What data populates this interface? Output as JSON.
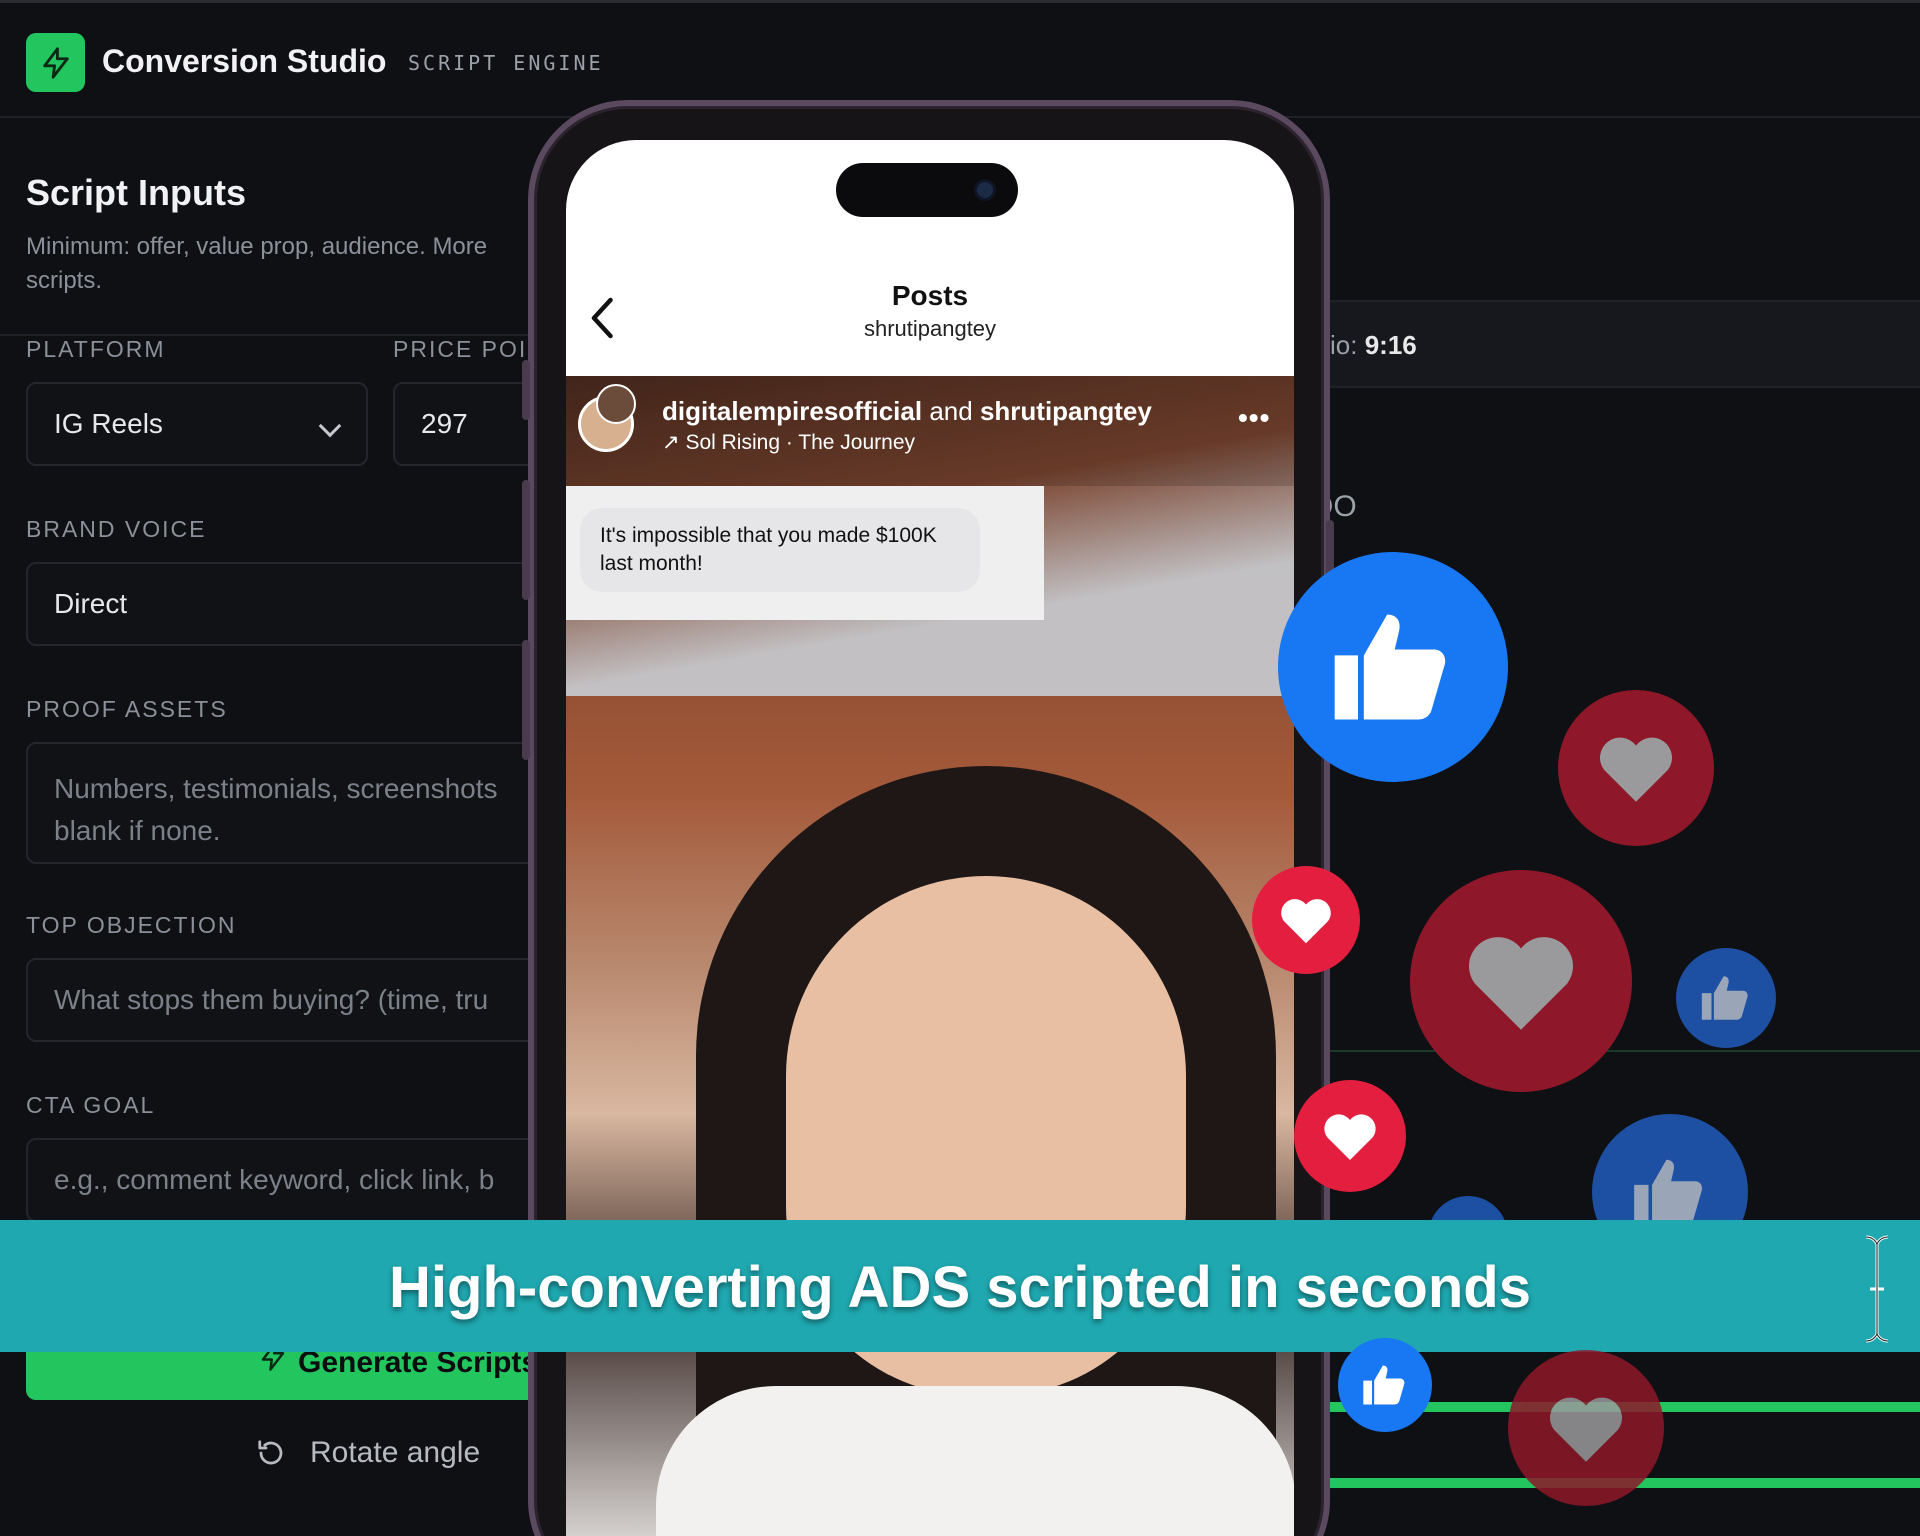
{
  "header": {
    "app_title": "Conversion Studio",
    "app_subtitle": "SCRIPT ENGINE",
    "logo_icon": "bolt-icon"
  },
  "form": {
    "title": "Script Inputs",
    "description_line1": "Minimum: offer, value prop, audience. More",
    "description_line2": "scripts.",
    "platform": {
      "label": "PLATFORM",
      "value": "IG Reels"
    },
    "price_point": {
      "label": "PRICE POI",
      "value": "297"
    },
    "brand_voice": {
      "label": "BRAND VOICE",
      "value": "Direct"
    },
    "proof_assets": {
      "label": "PROOF ASSETS",
      "placeholder_line1": "Numbers, testimonials, screenshots",
      "placeholder_line2": "blank if none."
    },
    "top_objection": {
      "label": "TOP OBJECTION",
      "placeholder": "What stops them buying? (time, tru"
    },
    "cta_goal": {
      "label": "CTA GOAL",
      "placeholder": "e.g., comment keyword, click link, b"
    },
    "generate_button": "Generate Scripts",
    "rotate_button": "Rotate angle"
  },
  "right_panel": {
    "ratio_prefix": "io:",
    "ratio_value": "9:16",
    "partial_text": "OO"
  },
  "phone": {
    "screen_title": "Posts",
    "screen_subtitle": "shrutipangtey",
    "post_author_1": "digitalempiresofficial",
    "post_author_joiner": "and",
    "post_author_2": "shrutipangtey",
    "music": "Sol Rising · The Journey",
    "more_icon": "more-dots-icon",
    "quote_line1": "It's impossible that you made $100K",
    "quote_line2": "last month!"
  },
  "caption": "High-converting ADS scripted in seconds",
  "colors": {
    "accent_green": "#22c55e",
    "banner_teal": "#1fa8b0",
    "like_blue": "#1877f2",
    "heart_red": "#e41e3f"
  }
}
